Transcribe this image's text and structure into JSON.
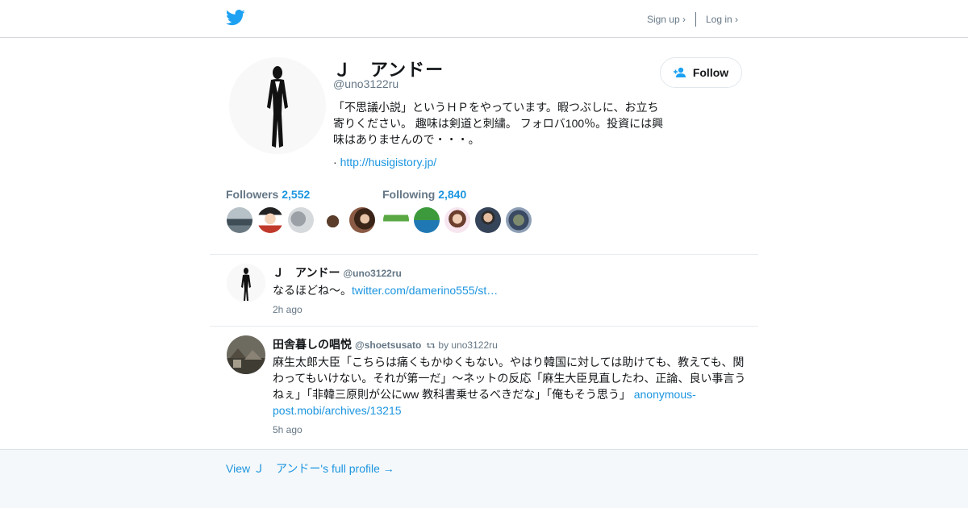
{
  "header": {
    "signup_label": "Sign up ›",
    "login_label": "Log in ›",
    "brand_color": "#1da1f2"
  },
  "profile": {
    "name": "Ｊ　アンドー",
    "handle": "@uno3122ru",
    "follow_label": "Follow",
    "bio": "「不思議小説」というＨＰをやっています。暇つぶしに、お立ち寄りください。 趣味は剣道と刺繍。 フォロバ100％。投資には興味はありませんので・・・。",
    "url_prefix": "·",
    "url": "http://husigistory.jp/",
    "followers_label": "Followers",
    "followers_count": "2,552",
    "following_label": "Following",
    "following_count": "2,840"
  },
  "tweets": [
    {
      "name": "Ｊ　アンドー",
      "handle": "@uno3122ru",
      "retweet": "",
      "text": "なるほどね～。",
      "link": "twitter.com/damerino555/st…",
      "time": "2h ago"
    },
    {
      "name": "田舎暮しの唱悦",
      "handle": "@shoetsusato",
      "retweet": "by uno3122ru",
      "text": "麻生太郎大臣「こちらは痛くもかゆくもない。やはり韓国に対しては助けても、教えても、関わってもいけない。それが第一だ」〜ネットの反応「麻生大臣見直したわ、正論、良い事言うねぇ」「非韓三原則が公にww 教科書乗せるべきだな」「俺もそう思う」",
      "link": "anonymous-post.mobi/archives/13215",
      "time": "5h ago"
    }
  ],
  "footer": {
    "full_profile_link": "View Ｊ　アンドー's full profile →"
  }
}
